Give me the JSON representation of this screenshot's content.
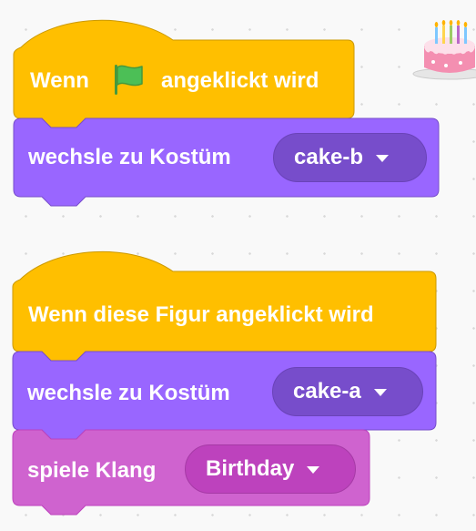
{
  "script1": {
    "hat": {
      "prefix": "Wenn",
      "icon": "green-flag-icon",
      "suffix": "angeklickt wird"
    },
    "switch_costume": {
      "label": "wechsle zu Kostüm",
      "costume": "cake-b"
    }
  },
  "script2": {
    "hat": {
      "label": "Wenn diese Figur angeklickt wird"
    },
    "switch_costume": {
      "label": "wechsle zu Kostüm",
      "costume": "cake-a"
    },
    "play_sound": {
      "label": "spiele Klang",
      "sound": "Birthday"
    }
  },
  "sprite": {
    "icon": "birthday-cake-icon"
  },
  "colors": {
    "events_fill": "#ffbf00",
    "events_stroke": "#cc9900",
    "looks_fill": "#9966ff",
    "looks_stroke": "#774dcb",
    "sound_fill": "#cf63cf",
    "sound_stroke": "#bd42bd",
    "flag_green": "#4cbf56",
    "background": "#f9f9f9"
  }
}
